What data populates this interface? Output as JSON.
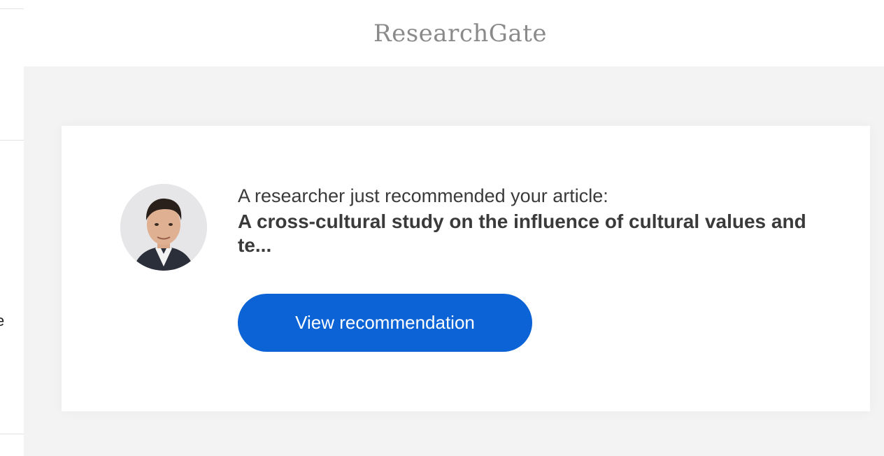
{
  "brand": {
    "name": "ResearchGate"
  },
  "left_pane": {
    "cut_text": "e"
  },
  "notification": {
    "intro": "A researcher just recommended your article:",
    "article_title": "A cross-cultural study on the influence of cultural values and te...",
    "button_label": "View recommendation",
    "avatar_icon": "person-avatar-photo"
  },
  "colors": {
    "button": "#0b63d6",
    "background": "#f3f3f3",
    "brand_text": "#8a8a8a"
  }
}
